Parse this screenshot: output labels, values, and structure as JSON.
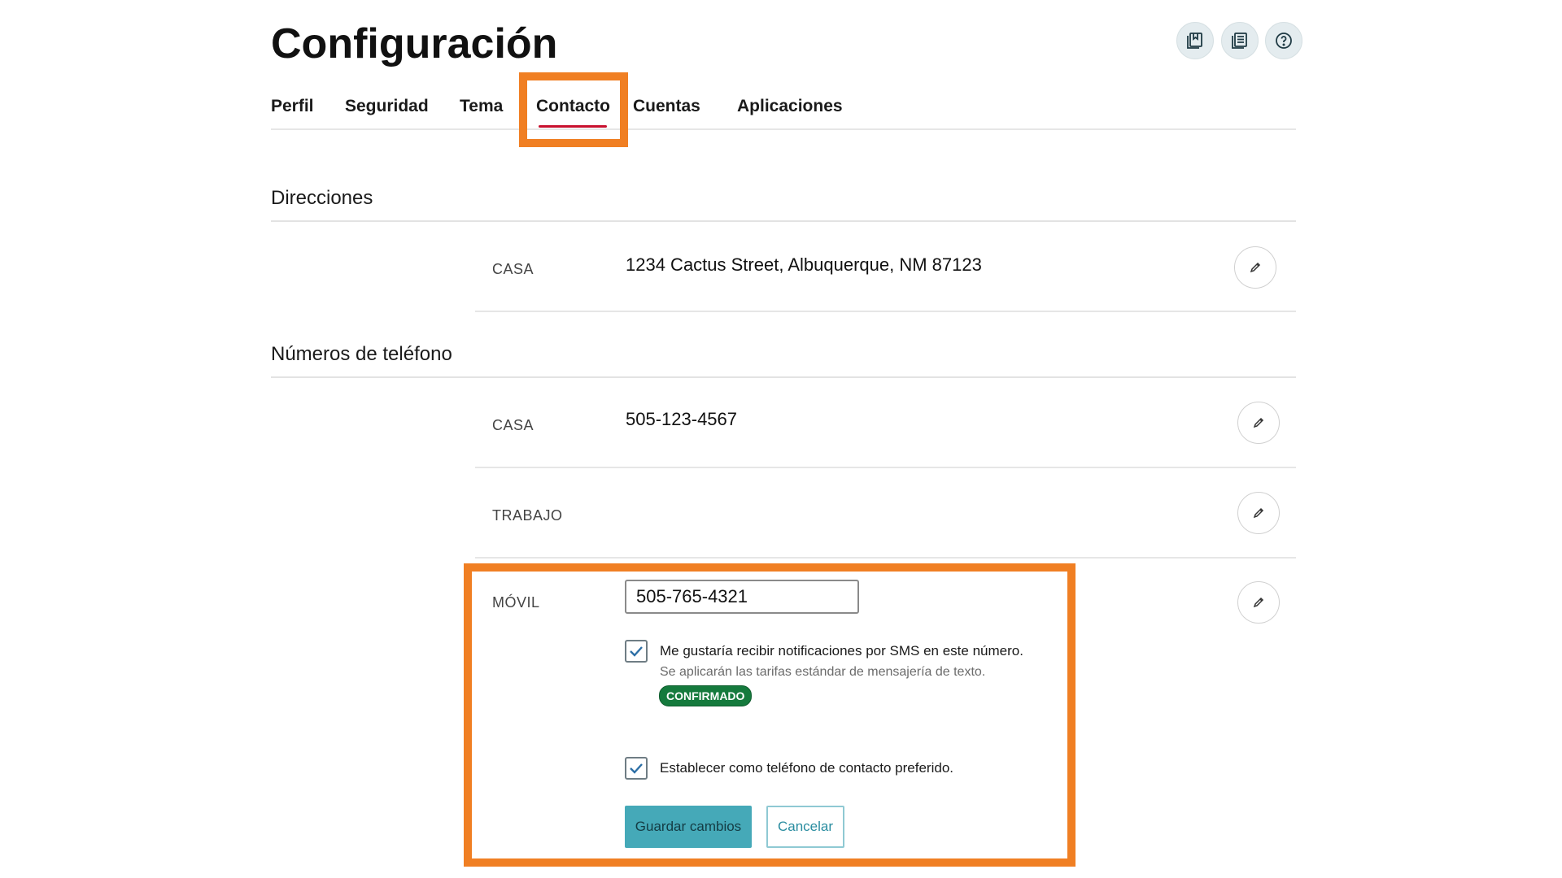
{
  "colors": {
    "highlight": "#f07f23",
    "active_tab_underline": "#c8102e",
    "primary_button": "#45a9b8",
    "badge": "#157a3d",
    "header_icon_bg": "#e4ecef"
  },
  "header": {
    "title": "Configuración",
    "icons": [
      "bookmark-book-icon",
      "document-list-icon",
      "help-circle-icon"
    ]
  },
  "tabs": [
    {
      "label": "Perfil",
      "active": false
    },
    {
      "label": "Seguridad",
      "active": false
    },
    {
      "label": "Tema",
      "active": false
    },
    {
      "label": "Contacto",
      "active": true
    },
    {
      "label": "Cuentas",
      "active": false
    },
    {
      "label": "Aplicaciones",
      "active": false
    }
  ],
  "addresses": {
    "title": "Direcciones",
    "rows": [
      {
        "label": "CASA",
        "value": "1234 Cactus Street, Albuquerque, NM 87123"
      }
    ]
  },
  "phones": {
    "title": "Números de teléfono",
    "rows": [
      {
        "label": "CASA",
        "value": "505-123-4567"
      },
      {
        "label": "TRABAJO",
        "value": ""
      },
      {
        "label": "MÓVIL",
        "value": "505-765-4321"
      }
    ]
  },
  "mobile_edit": {
    "input_value": "505-765-4321",
    "sms_checked": true,
    "sms_label": "Me gustaría recibir notificaciones por SMS en este número.",
    "sms_hint": "Se aplicarán las tarifas estándar de mensajería de texto.",
    "sms_badge": "CONFIRMADO",
    "preferred_checked": true,
    "preferred_label": "Establecer como teléfono de contacto preferido.",
    "save_label": "Guardar cambios",
    "cancel_label": "Cancelar"
  }
}
